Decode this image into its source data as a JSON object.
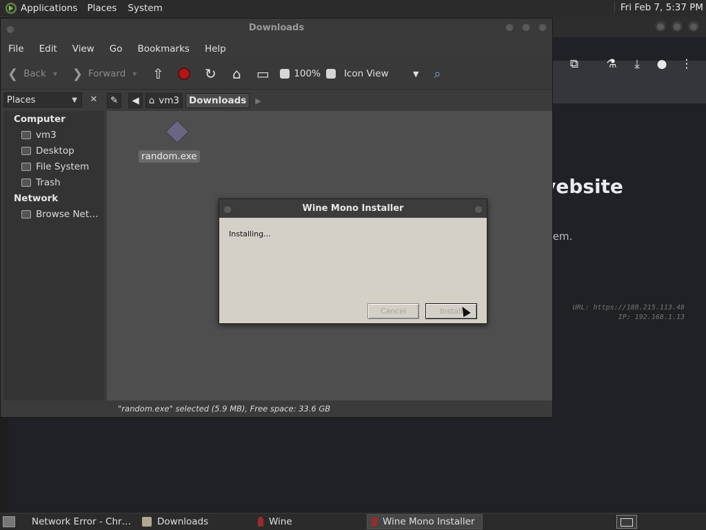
{
  "top_panel": {
    "applications": "Applications",
    "places": "Places",
    "system": "System",
    "clock": "Fri Feb  7, 5:37 PM"
  },
  "browser": {
    "heading": "vebsite",
    "line": "blem.",
    "url_line": "URL: https://188.215.113.48",
    "ip_line": "IP: 192.168.1.13"
  },
  "file_manager": {
    "title": "Downloads",
    "menu": [
      "File",
      "Edit",
      "View",
      "Go",
      "Bookmarks",
      "Help"
    ],
    "toolbar": {
      "back": "Back",
      "forward": "Forward",
      "zoom": "100%",
      "view_mode": "Icon View"
    },
    "sidebar_selector": "Places",
    "sidebar": {
      "computer_heading": "Computer",
      "items_computer": [
        "vm3",
        "Desktop",
        "File System",
        "Trash"
      ],
      "network_heading": "Network",
      "items_network": [
        "Browse Net…"
      ]
    },
    "path": [
      "vm3",
      "Downloads"
    ],
    "file": {
      "name": "random.exe"
    },
    "status": "\"random.exe\" selected (5.9 MB), Free space: 33.6 GB"
  },
  "dialog": {
    "title": "Wine Mono Installer",
    "message": "Installing...",
    "cancel": "Cancel",
    "install": "Install"
  },
  "taskbar": {
    "tasks": [
      "Network Error - Chr…",
      "Downloads",
      "Wine",
      "Wine Mono Installer"
    ]
  }
}
